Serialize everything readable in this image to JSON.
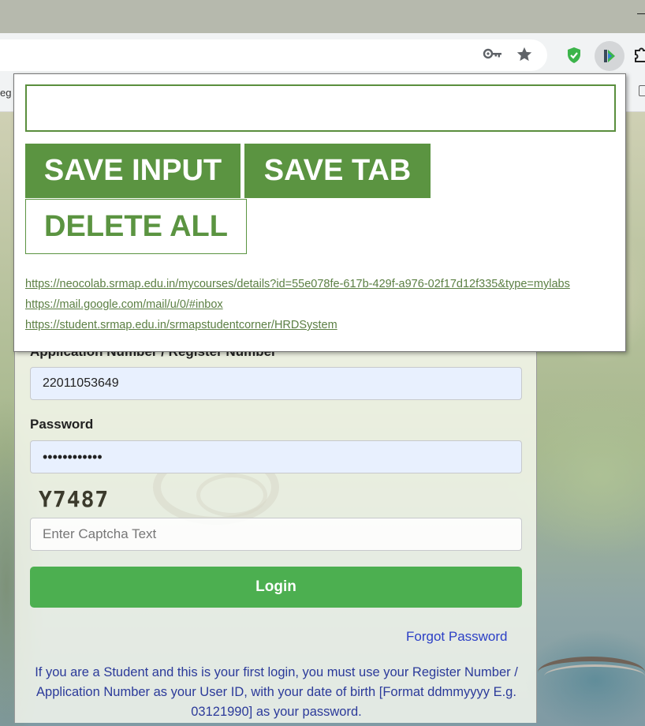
{
  "browser": {
    "bookmark_fragment": "eg",
    "extension_icons": [
      "key-icon",
      "star-icon",
      "shield-extension-icon",
      "active-extension-icon",
      "puzzle-icon"
    ]
  },
  "popup": {
    "input_value": "",
    "save_input_label": "SAVE INPUT",
    "save_tab_label": "SAVE TAB",
    "delete_all_label": "DELETE ALL",
    "links": [
      "https://neocolab.srmap.edu.in/mycourses/details?id=55e078fe-617b-429f-a976-02f17d12f335&type=mylabs",
      "https://mail.google.com/mail/u/0/#inbox",
      "https://student.srmap.edu.in/srmapstudentcorner/HRDSystem"
    ],
    "colors": {
      "accent": "#5b9441",
      "link": "#5b7f43"
    }
  },
  "login": {
    "appno_label": "Application Number / Register Number",
    "appno_value": "22011053649",
    "password_label": "Password",
    "password_value": "••••••••••••",
    "captcha_text": "Y7487",
    "captcha_placeholder": "Enter Captcha Text",
    "login_label": "Login",
    "forgot_label": "Forgot Password",
    "notice": "If you are a Student and this is your first login, you must use your Register Number / Application Number as your User ID, with your date of birth [Format ddmmyyyy E.g. 03121990] as your password.",
    "colors": {
      "button": "#4caf50",
      "link": "#2b3fc6",
      "notice": "#2b3a9a"
    }
  }
}
